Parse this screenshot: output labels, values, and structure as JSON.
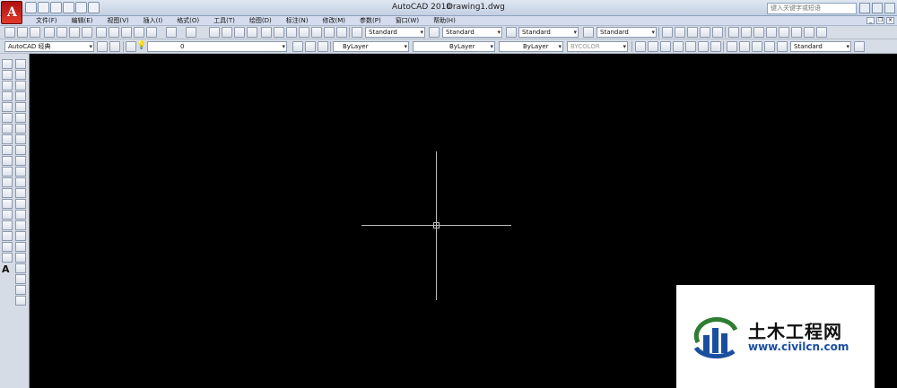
{
  "titlebar": {
    "app_title": "AutoCAD 2010",
    "document": "Drawing1.dwg",
    "search_placeholder": "键入关键字或短语"
  },
  "menu": [
    "文件(F)",
    "编辑(E)",
    "视图(V)",
    "插入(I)",
    "格式(O)",
    "工具(T)",
    "绘图(D)",
    "标注(N)",
    "修改(M)",
    "参数(P)",
    "窗口(W)",
    "帮助(H)"
  ],
  "toolbar": {
    "text_style": "Standard",
    "dim_style": "Standard",
    "table_style": "Standard",
    "mleader_style": "Standard",
    "workspace": "AutoCAD 经典",
    "layer": "0",
    "color": "ByLayer",
    "linetype": "ByLayer",
    "lineweight": "ByLayer",
    "plotstyle": "BYCOLOR",
    "scale_style": "Standard"
  },
  "watermark": {
    "title": "土木工程网",
    "url": "www.civilcn.com"
  },
  "colors": {
    "canvas": "#000000",
    "crosshair": "#bdbdbd",
    "watermark_blue": "#1a4fa0"
  }
}
